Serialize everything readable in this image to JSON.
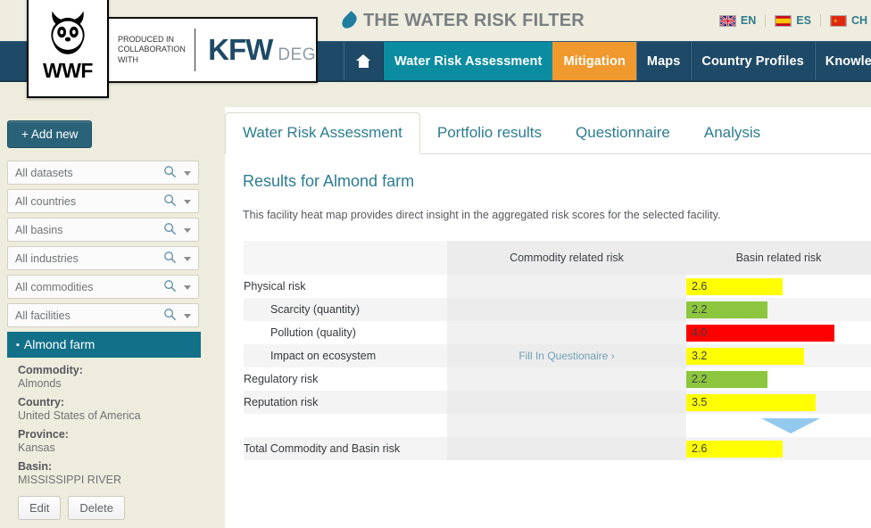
{
  "brand": {
    "wwf_text": "WWF",
    "produced_line1": "PRODUCED IN",
    "produced_line2": "COLLABORATION",
    "produced_line3": "WITH",
    "kfw_main": "KFW",
    "kfw_sub": "DEG",
    "site_title": "THE WATER RISK FILTER",
    "drop_icon": "water-drop-icon"
  },
  "languages": [
    {
      "code": "EN",
      "flag": "uk-flag-icon"
    },
    {
      "code": "ES",
      "flag": "spain-flag-icon"
    },
    {
      "code": "CH",
      "flag": "china-flag-icon"
    }
  ],
  "nav": {
    "home_icon": "home-icon",
    "items": [
      {
        "label": "Water Risk Assessment",
        "state": "active-teal"
      },
      {
        "label": "Mitigation",
        "state": "active-orange"
      },
      {
        "label": "Maps",
        "state": ""
      },
      {
        "label": "Country Profiles",
        "state": ""
      },
      {
        "label": "Knowledge Base",
        "state": ""
      }
    ]
  },
  "sidebar": {
    "add_new_label": "+ Add new",
    "filters": [
      {
        "label": "All datasets"
      },
      {
        "label": "All countries"
      },
      {
        "label": "All basins"
      },
      {
        "label": "All industries"
      },
      {
        "label": "All commodities"
      },
      {
        "label": "All facilities"
      }
    ],
    "selected_facility": "Almond farm",
    "details": [
      {
        "key": "Commodity:",
        "value": "Almonds"
      },
      {
        "key": "Country:",
        "value": "United States of America"
      },
      {
        "key": "Province:",
        "value": "Kansas"
      },
      {
        "key": "Basin:",
        "value": "MISSISSIPPI RIVER"
      }
    ],
    "edit_label": "Edit",
    "delete_label": "Delete"
  },
  "main": {
    "tabs": [
      {
        "label": "Water Risk Assessment",
        "active": true
      },
      {
        "label": "Portfolio results",
        "active": false
      },
      {
        "label": "Questionnaire",
        "active": false
      },
      {
        "label": "Analysis",
        "active": false
      }
    ],
    "results_title": "Results for Almond farm",
    "results_desc": "This facility heat map provides direct insight in the aggregated risk scores for the selected facility."
  },
  "chart_data": {
    "type": "heatmap",
    "title": "Results for Almond farm",
    "columns": [
      "",
      "Commodity related risk",
      "Basin related risk"
    ],
    "scale_max": 5.0,
    "colors": {
      "low": "#8cc63e",
      "medium": "#ffff00",
      "high": "#ff0000"
    },
    "rows": [
      {
        "label": "Physical risk",
        "indent": false,
        "commodity": "",
        "basin_value": "2.6",
        "basin_num": 2.6,
        "color": "#ffff00",
        "row_style": "odd"
      },
      {
        "label": "Scarcity (quantity)",
        "indent": true,
        "commodity": "",
        "basin_value": "2.2",
        "basin_num": 2.2,
        "color": "#8cc63e",
        "row_style": "even"
      },
      {
        "label": "Pollution (quality)",
        "indent": true,
        "commodity": "",
        "basin_value": "4.0",
        "basin_num": 4.0,
        "color": "#ff0000",
        "row_style": "odd"
      },
      {
        "label": "Impact on ecosystem",
        "indent": true,
        "commodity": "Fill In Questionaire ›",
        "basin_value": "3.2",
        "basin_num": 3.2,
        "color": "#ffff00",
        "row_style": "even"
      },
      {
        "label": "Regulatory risk",
        "indent": false,
        "commodity": "",
        "basin_value": "2.2",
        "basin_num": 2.2,
        "color": "#8cc63e",
        "row_style": "odd"
      },
      {
        "label": "Reputation risk",
        "indent": false,
        "commodity": "",
        "basin_value": "3.5",
        "basin_num": 3.5,
        "color": "#ffff00",
        "row_style": "even"
      }
    ],
    "total_row": {
      "label": "Total Commodity and Basin risk",
      "commodity": "",
      "basin_value": "2.6",
      "basin_num": 2.6,
      "color": "#ffff00"
    },
    "arrow_icon": "arrow-down-icon"
  }
}
